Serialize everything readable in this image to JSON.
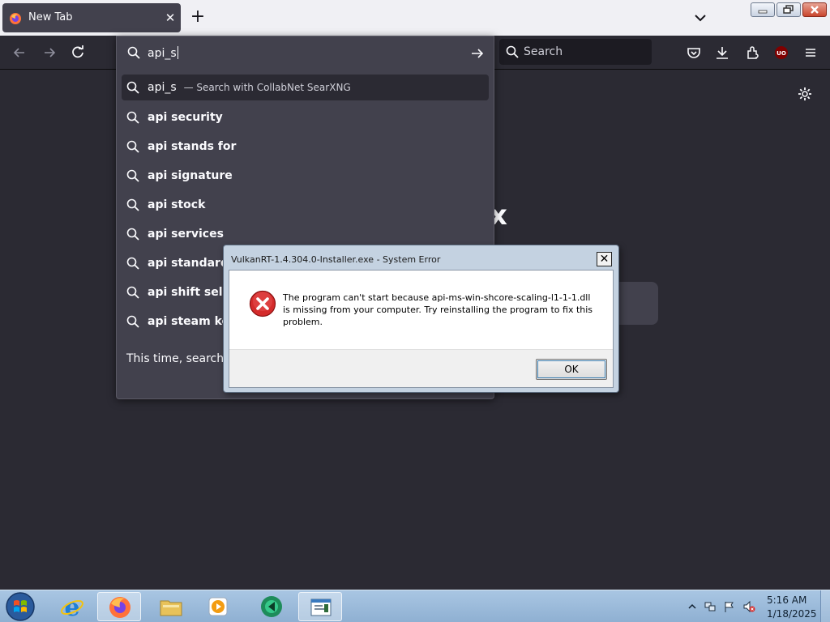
{
  "browser": {
    "tab": {
      "title": "New Tab"
    },
    "new_tab_label": "+",
    "right_search_placeholder": "Search"
  },
  "urlbar": {
    "value": "api_s",
    "results": [
      {
        "text": "api_s",
        "suffix": "— Search with CollabNet SearXNG",
        "selected": true
      },
      {
        "text": "api security"
      },
      {
        "text": "api stands for"
      },
      {
        "text": "api signature"
      },
      {
        "text": "api stock"
      },
      {
        "text": "api services"
      },
      {
        "text": "api standards"
      },
      {
        "text": "api shift select"
      },
      {
        "text": "api steam key"
      }
    ],
    "oneoff_label": "This time, search with:"
  },
  "page": {
    "logo_glyph": "x"
  },
  "dialog": {
    "title": "VulkanRT-1.4.304.0-Installer.exe - System Error",
    "message": "The program can't start because api-ms-win-shcore-scaling-l1-1-1.dll is missing from your computer. Try reinstalling the program to fix this problem.",
    "ok_label": "OK",
    "close_label": "✕"
  },
  "taskbar": {
    "clock_time": "5:16 AM",
    "clock_date": "1/18/2025",
    "items": [
      "internet-explorer",
      "firefox",
      "file-explorer",
      "media-player",
      "app",
      "notepad"
    ]
  },
  "colors": {
    "browser_dark": "#2b2a33",
    "panel": "#42414d",
    "dialog_frame": "#c4d2e1",
    "error_red": "#d42b2b"
  }
}
